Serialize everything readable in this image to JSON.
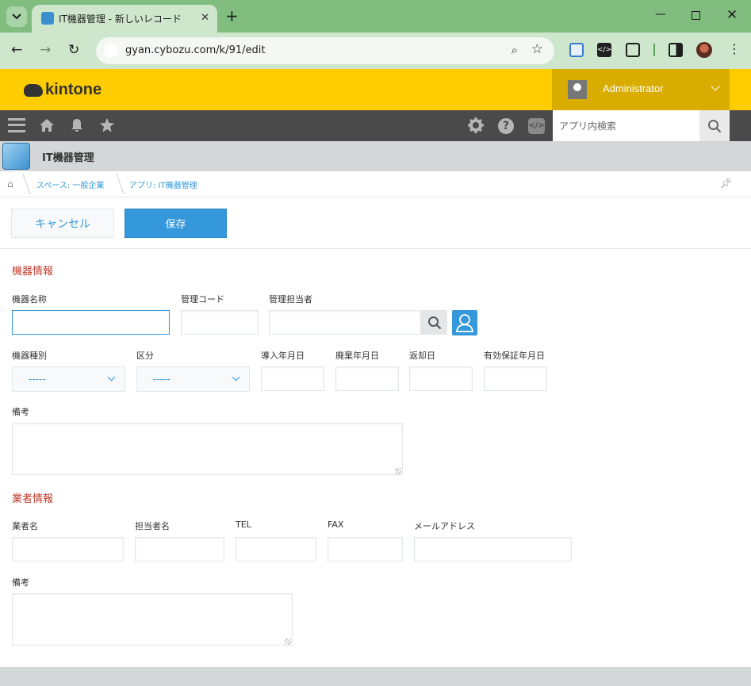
{
  "browser": {
    "tab_title": "IT機器管理 - 新しいレコード",
    "url": "gyan.cybozu.com/k/91/edit"
  },
  "header": {
    "logo_text": "kintone",
    "user_name": "Administrator"
  },
  "global_nav": {
    "search_placeholder": "アプリ内検索"
  },
  "app": {
    "name": "IT機器管理"
  },
  "breadcrumb": {
    "space": "スペース: 一般企業",
    "app": "アプリ: IT機器管理"
  },
  "actions": {
    "cancel_label": "キャンセル",
    "save_label": "保存"
  },
  "form": {
    "section1_title": "機器情報",
    "device_name_label": "機器名称",
    "management_code_label": "管理コード",
    "manager_label": "管理担当者",
    "device_type_label": "機器種別",
    "device_type_value": "-----",
    "category_label": "区分",
    "category_value": "-----",
    "install_date_label": "導入年月日",
    "disposal_date_label": "廃棄年月日",
    "return_date_label": "返却日",
    "warranty_date_label": "有効保証年月日",
    "notes1_label": "備考",
    "section2_title": "業者情報",
    "vendor_name_label": "業者名",
    "contact_name_label": "担当者名",
    "tel_label": "TEL",
    "fax_label": "FAX",
    "email_label": "メールアドレス",
    "notes2_label": "備考"
  },
  "colors": {
    "brand": "#ffcc00",
    "accent": "#3498db",
    "section_title": "#c0392b",
    "nav_bg": "#4a4a4a"
  }
}
